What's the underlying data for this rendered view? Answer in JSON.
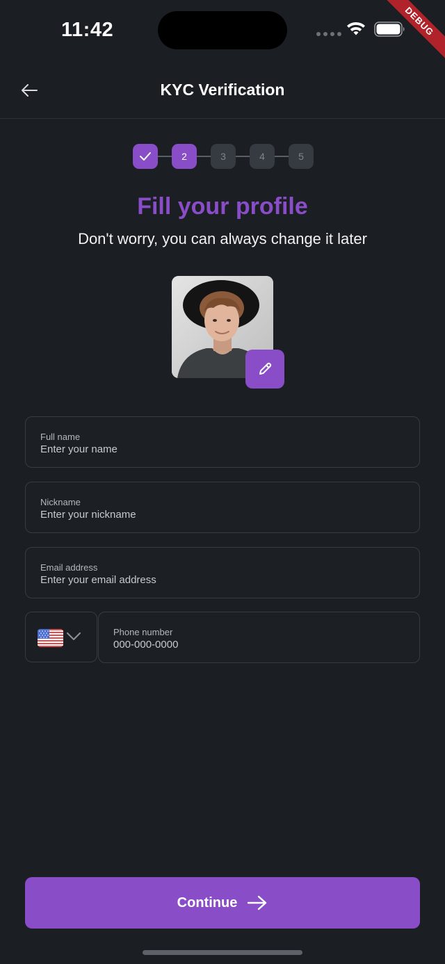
{
  "status_bar": {
    "time": "11:42",
    "debug_label": "DEBUG"
  },
  "header": {
    "title": "KYC Verification",
    "back_icon": "arrow-left-icon"
  },
  "stepper": {
    "steps": [
      {
        "label": "",
        "state": "done",
        "icon": "check-icon"
      },
      {
        "label": "2",
        "state": "active"
      },
      {
        "label": "3",
        "state": "pending"
      },
      {
        "label": "4",
        "state": "pending"
      },
      {
        "label": "5",
        "state": "pending"
      }
    ]
  },
  "profile": {
    "heading": "Fill your profile",
    "subheading": "Don't worry, you can always change it later",
    "edit_icon": "pencil-icon"
  },
  "form": {
    "full_name": {
      "label": "Full name",
      "placeholder": "Enter your name"
    },
    "nickname": {
      "label": "Nickname",
      "placeholder": "Enter your nickname"
    },
    "email": {
      "label": "Email address",
      "placeholder": "Enter your email address"
    },
    "phone": {
      "label": "Phone number",
      "placeholder": "000-000-0000",
      "country_icon": "us-flag-icon"
    }
  },
  "actions": {
    "continue_label": "Continue",
    "continue_icon": "arrow-right-icon"
  },
  "colors": {
    "accent": "#8a4dc8",
    "background": "#1b1f24",
    "border": "#373c42"
  }
}
